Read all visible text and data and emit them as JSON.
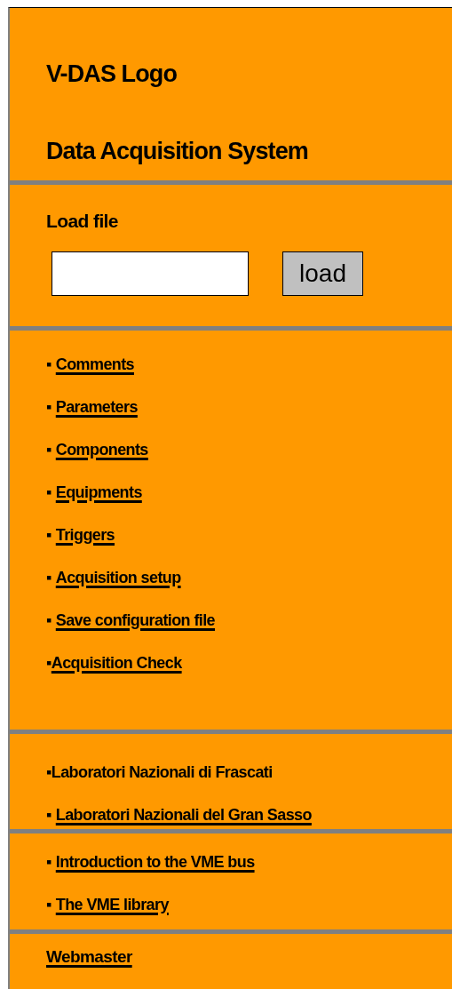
{
  "header": {
    "logo": "V-DAS Logo",
    "title": "Data Acquisition System"
  },
  "load_file": {
    "label": "Load file",
    "button": "load"
  },
  "sections": [
    {
      "items": [
        {
          "bullet": "▪",
          "text": "Comments",
          "kind": "link",
          "spaced": true
        },
        {
          "bullet": "▪",
          "text": "Parameters",
          "kind": "link",
          "spaced": true
        },
        {
          "bullet": "▪",
          "text": "Components",
          "kind": "link",
          "spaced": true
        },
        {
          "bullet": "▪",
          "text": "Equipments",
          "kind": "link",
          "spaced": true
        },
        {
          "bullet": "▪",
          "text": "Triggers",
          "kind": "link",
          "spaced": true
        },
        {
          "bullet": "▪",
          "text": "Acquisition setup",
          "kind": "link",
          "spaced": true
        },
        {
          "bullet": "▪",
          "text": "Save configuration file",
          "kind": "link",
          "spaced": true
        },
        {
          "bullet": "▪",
          "text": "Acquisition Check",
          "kind": "link",
          "spaced": false
        }
      ]
    },
    {
      "items": [
        {
          "bullet": "▪",
          "text": "Laboratori Nazionali di Frascati",
          "kind": "plain",
          "spaced": false
        },
        {
          "bullet": "▪",
          "text": "Laboratori Nazionali del Gran Sasso",
          "kind": "link",
          "spaced": true
        }
      ]
    },
    {
      "items": [
        {
          "bullet": "▪",
          "text": "Introduction to the VME bus",
          "kind": "link",
          "spaced": true
        },
        {
          "bullet": "▪",
          "text": "The VME library",
          "kind": "link",
          "spaced": true
        }
      ]
    }
  ],
  "footer": {
    "link": "Webmaster"
  }
}
